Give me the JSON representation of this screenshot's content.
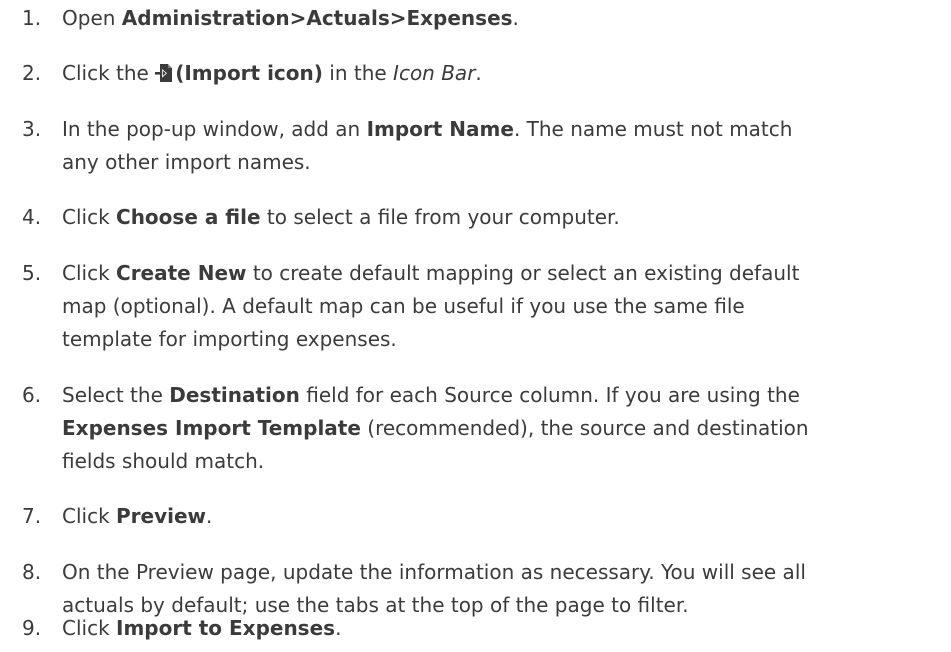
{
  "steps": [
    {
      "number": "1.",
      "lines": [
        [
          "Open ",
          "Administration>Actuals>Expenses",
          "."
        ]
      ]
    },
    {
      "number": "2.",
      "lines": [
        [
          "Click the ",
          "(Import icon)",
          " in the ",
          "Icon Bar",
          "."
        ]
      ],
      "icon": "import-icon"
    },
    {
      "number": "3.",
      "lines": [
        [
          "In the pop-up window, add an ",
          "Import Name",
          ". The name must not match"
        ],
        [
          "any other import names."
        ]
      ]
    },
    {
      "number": "4.",
      "lines": [
        [
          "Click ",
          "Choose a file",
          " to select a file from your computer."
        ]
      ]
    },
    {
      "number": "5.",
      "lines": [
        [
          "Click ",
          "Create New",
          " to create default mapping or select an existing default"
        ],
        [
          "map (optional). A default map can be useful if you use the same file"
        ],
        [
          "template for importing expenses."
        ]
      ]
    },
    {
      "number": "6.",
      "lines": [
        [
          "Select the ",
          "Destination",
          " field for each Source column. If you are using the"
        ],
        [
          "Expenses Import Template",
          " (recommended), the source and destination"
        ],
        [
          "fields should match."
        ]
      ]
    },
    {
      "number": "7.",
      "lines": [
        [
          "Click ",
          "Preview",
          "."
        ]
      ]
    },
    {
      "number": "8.",
      "lines": [
        [
          "On the Preview page, update the information as necessary. You will see all"
        ],
        [
          "actuals by default; use the tabs at the top of the page to filter."
        ]
      ]
    },
    {
      "number": "9.",
      "lines": [
        [
          "Click ",
          "Import to Expenses",
          "."
        ]
      ]
    }
  ]
}
